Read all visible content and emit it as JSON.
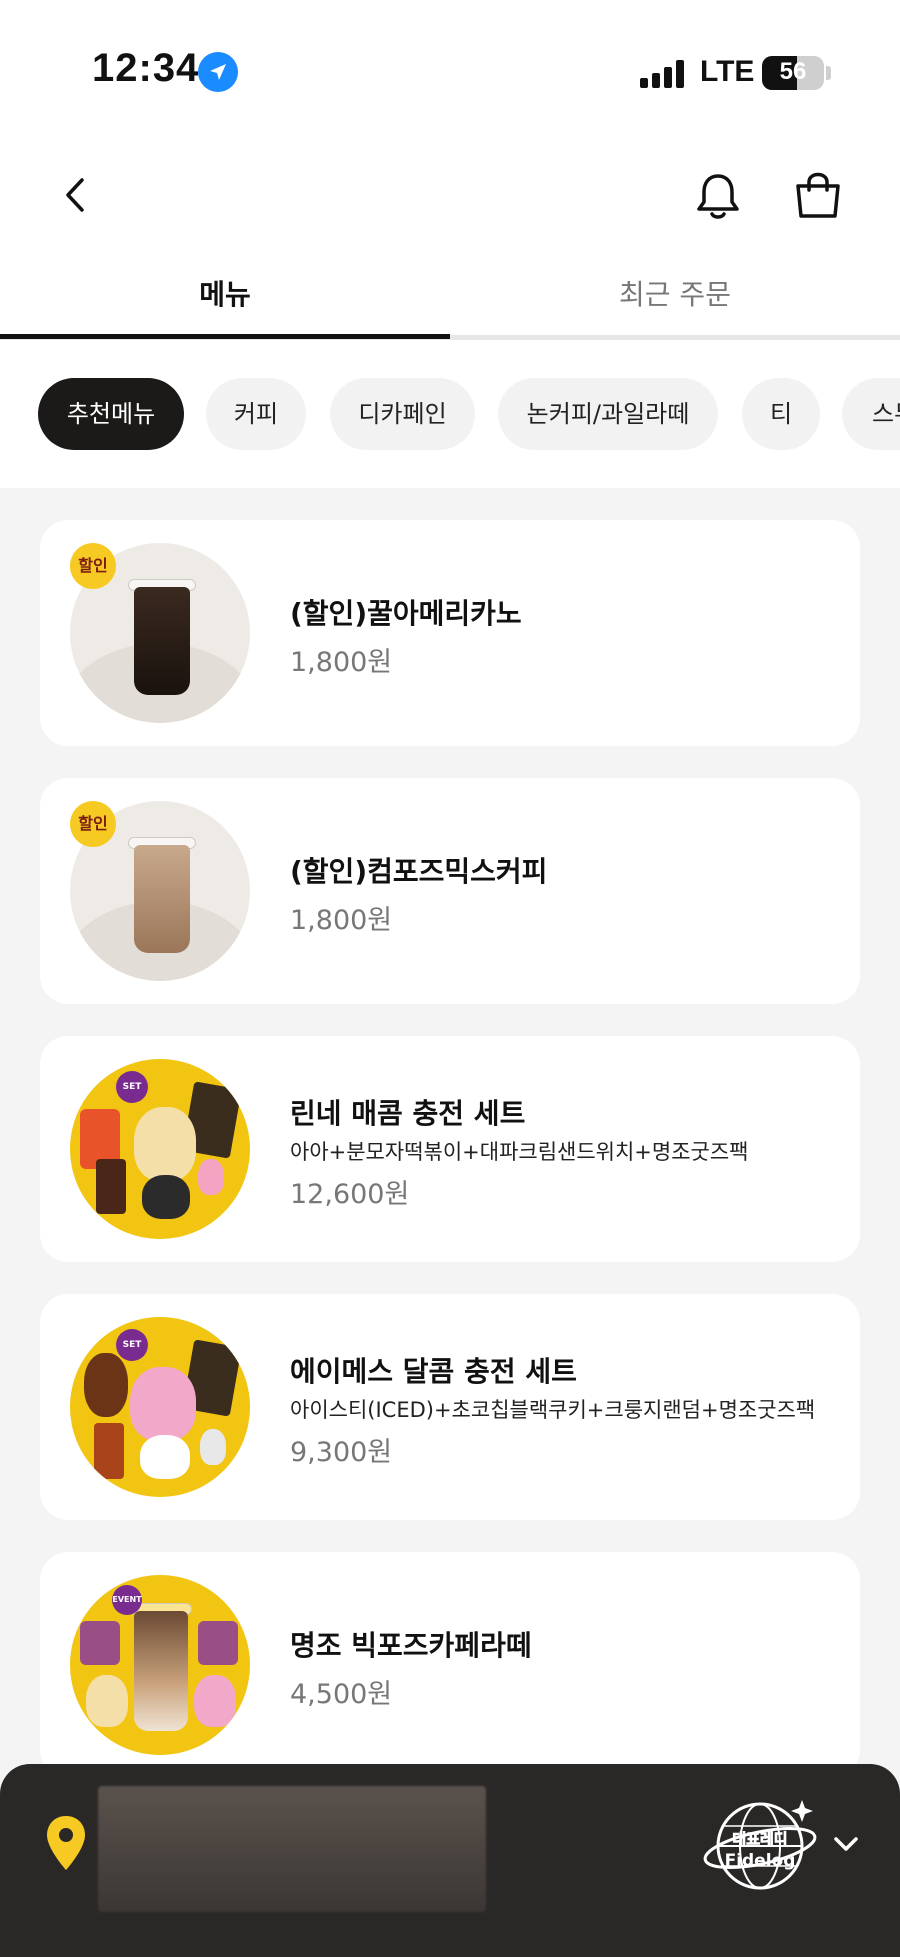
{
  "status_bar": {
    "time": "12:34",
    "network": "LTE",
    "battery_level": "56",
    "battery_fraction": 0.56
  },
  "header": {
    "back_icon": "chevron-left-icon",
    "notification_icon": "bell-icon",
    "cart_icon": "shopping-bag-icon"
  },
  "tabs": [
    {
      "label": "메뉴",
      "active": true
    },
    {
      "label": "최근 주문",
      "active": false
    }
  ],
  "categories": [
    {
      "label": "추천메뉴",
      "active": true
    },
    {
      "label": "커피",
      "active": false
    },
    {
      "label": "디카페인",
      "active": false
    },
    {
      "label": "논커피/과일라떼",
      "active": false
    },
    {
      "label": "티",
      "active": false
    },
    {
      "label": "스무",
      "active": false
    }
  ],
  "menu_items": [
    {
      "badge": "할인",
      "name": "(할인)꿀아메리카노",
      "description": "",
      "price": "1,800원"
    },
    {
      "badge": "할인",
      "name": "(할인)컴포즈믹스커피",
      "description": "",
      "price": "1,800원"
    },
    {
      "badge": "SET",
      "name": "린네 매콤 충전 세트",
      "description": "아아+분모자떡볶이+대파크림샌드위치+명조굿즈팩",
      "price": "12,600원"
    },
    {
      "badge": "SET",
      "name": "에이메스 달콤 충전 세트",
      "description": "아이스티(ICED)+초코칩블랙쿠키+크룽지랜덤+명조굿즈팩",
      "price": "9,300원"
    },
    {
      "badge": "EVENT",
      "name": "명조 빅포즈카페라떼",
      "description": "",
      "price": "4,500원"
    }
  ],
  "store_bar": {
    "location_icon": "map-pin-icon",
    "logo_text": "대표레디 Fidelog",
    "expand_icon": "chevron-down-icon"
  },
  "colors": {
    "accent_yellow": "#f7c923",
    "chip_active": "#1c1a19",
    "bottom_bar": "#2a2827",
    "location_blue": "#1a8cff"
  }
}
